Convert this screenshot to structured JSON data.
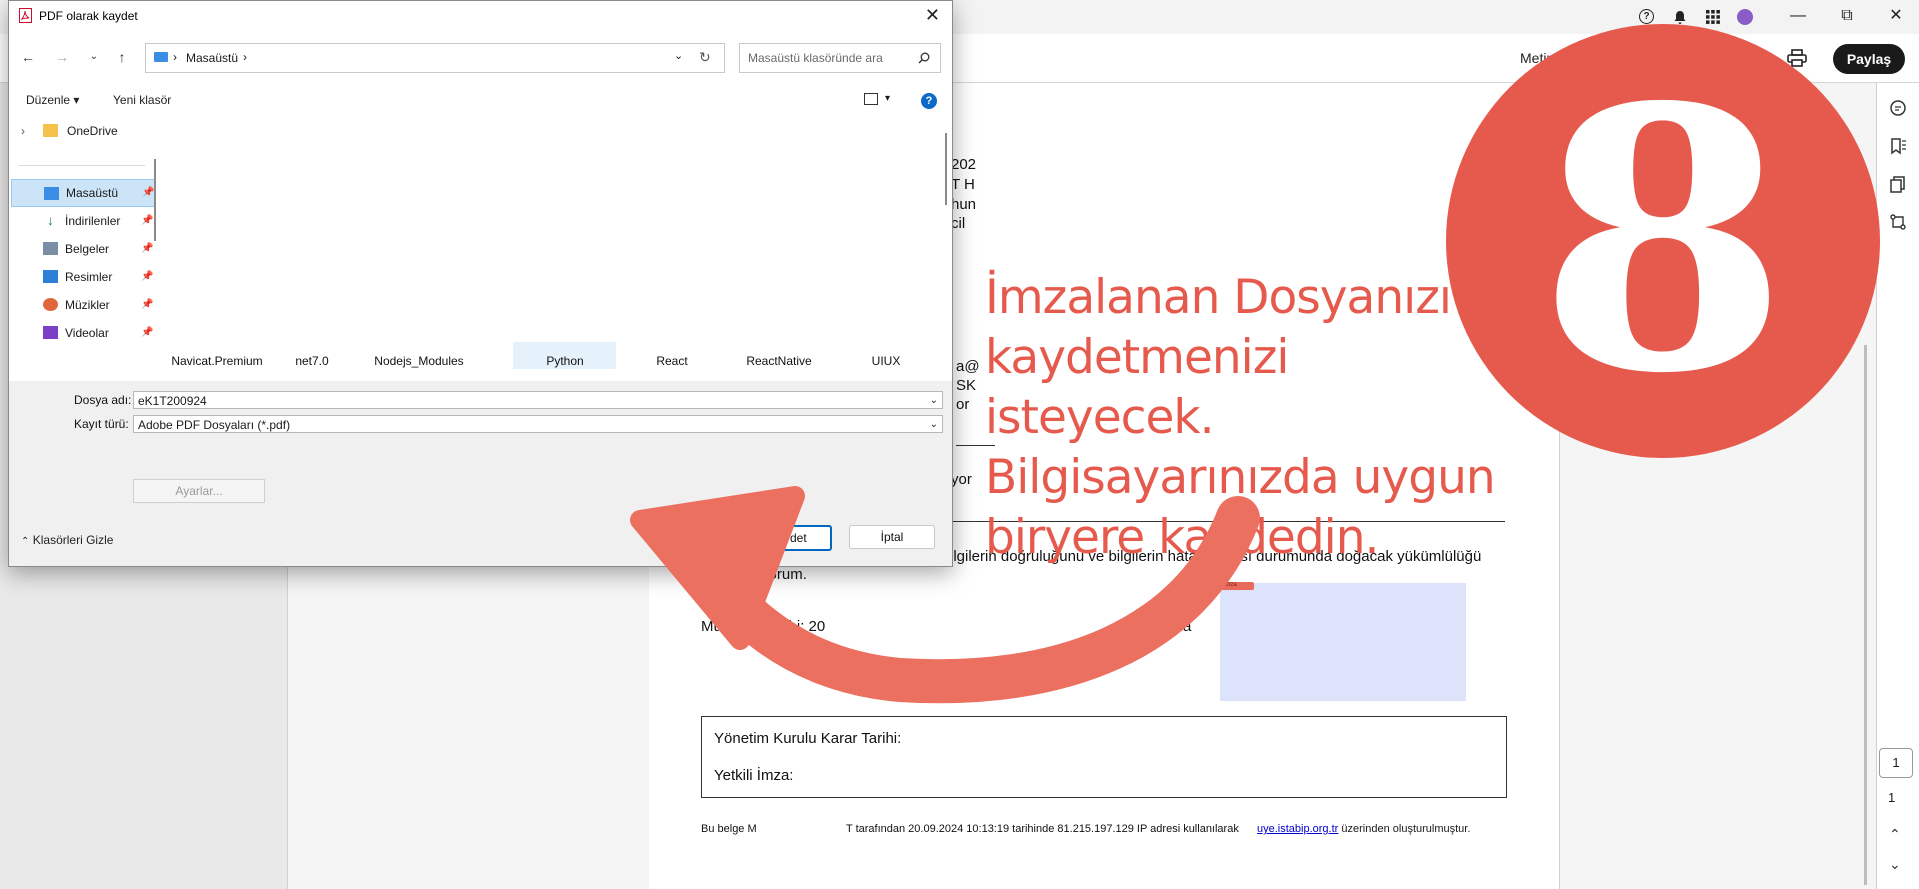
{
  "app": {
    "text_tab_label": "Metin",
    "share_label": "Paylaş",
    "icons": [
      "help-icon",
      "bell-icon",
      "apps-grid-icon",
      "avatar",
      "minimize-icon",
      "restore-icon",
      "close-icon",
      "print-icon"
    ],
    "right_rail_icons": [
      "comment-icon",
      "bookmark-icon",
      "pages-icon",
      "compare-icon"
    ],
    "page_number": "1",
    "page_total": "1"
  },
  "document": {
    "fragments": {
      "f1": "202",
      "f2": "T H",
      "f3": "hun",
      "f4": "cil",
      "f5": "a@",
      "f6": "SK",
      "f7": "or",
      "f8": "yor"
    },
    "declaration_line1": "ilgilerin doğruluğunu ve bilgilerin hatalı",
    "declaration_line1b": "ası durumunda doğacak yükümlülüğü",
    "declaration_line2": "kabul ediyorum.",
    "application_date": "Müracaat tarihi: 20",
    "application_date_tail": "a",
    "board_decision_date_label": "Yönetim Kurulu Karar Tarihi:",
    "authorized_signature_label": "Yetkili İmza:",
    "footer_prefix": "Bu belge M",
    "footer_middle": "T tarafından 20.09.2024 10:13:19 tarihinde 81.215.197.129 IP adresi kullanılarak",
    "footer_link": "uye.istabip.org.tr",
    "footer_suffix": "üzerinden oluşturulmuştur.",
    "signature_tag": "imza"
  },
  "overlay": {
    "step_number": "8",
    "callout": "İmzalanan Dosyanızı\nkaydetmenizi isteyecek.\nBilgisayarınızda uygun\n biryere kaydedin.",
    "accent_color": "#e65a4d"
  },
  "dialog": {
    "title": "PDF olarak kaydet",
    "address_path": "Masaüstü",
    "search_placeholder": "Masaüstü klasöründe ara",
    "organize_label": "Düzenle",
    "new_folder_label": "Yeni klasör",
    "nav_items": [
      {
        "label": "OneDrive",
        "icon": "folder-icon"
      },
      {
        "label": "Masaüstü",
        "icon": "desktop-icon"
      },
      {
        "label": "İndirilenler",
        "icon": "download-icon"
      },
      {
        "label": "Belgeler",
        "icon": "documents-icon"
      },
      {
        "label": "Resimler",
        "icon": "pictures-icon"
      },
      {
        "label": "Müzikler",
        "icon": "music-icon"
      },
      {
        "label": "Videolar",
        "icon": "videos-icon"
      }
    ],
    "files": [
      {
        "name": "Navicat.Premium"
      },
      {
        "name": "net7.0"
      },
      {
        "name": "Nodejs_Modules"
      },
      {
        "name": "Python"
      },
      {
        "name": "React"
      },
      {
        "name": "ReactNative"
      },
      {
        "name": "UIUX"
      }
    ],
    "file_name_label": "Dosya adı:",
    "file_name_value": "eK1T200924",
    "file_type_label": "Kayıt türü:",
    "file_type_value": "Adobe PDF Dosyaları (*.pdf)",
    "settings_label": "Ayarlar...",
    "hide_folders_label": "Klasörleri Gizle",
    "save_label": "Kaydet",
    "cancel_label": "İptal"
  }
}
